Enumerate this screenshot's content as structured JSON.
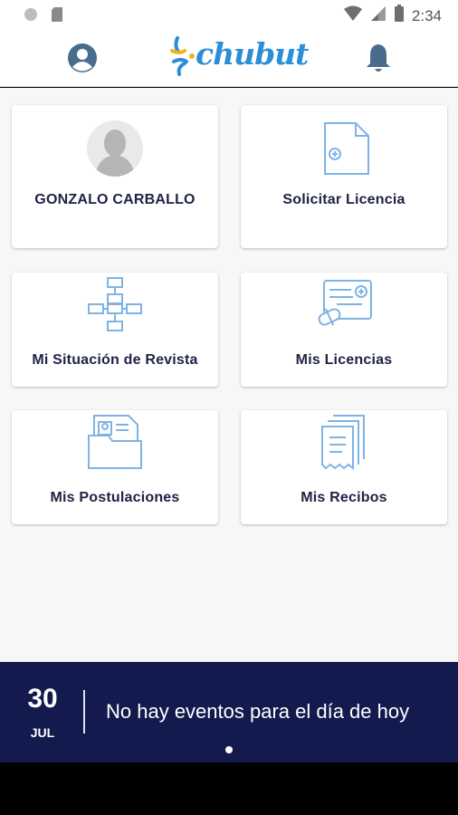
{
  "status_bar": {
    "time": "2:34",
    "icons": [
      "circle-icon",
      "sd-card-icon",
      "wifi-icon",
      "signal-icon",
      "battery-icon"
    ]
  },
  "app_bar": {
    "logo_text": "chubut",
    "icons": [
      "profile-icon",
      "bell-icon"
    ],
    "accent_color": "#2a8fd6"
  },
  "cards": [
    {
      "label": "GONZALO CARBALLO",
      "icon": "avatar-placeholder"
    },
    {
      "label": "Solicitar Licencia",
      "icon": "document-add-icon"
    },
    {
      "label": "Mi Situación de Revista",
      "icon": "org-chart-icon"
    },
    {
      "label": "Mis Licencias",
      "icon": "license-card-icon"
    },
    {
      "label": "Mis Postulaciones",
      "icon": "folder-id-icon"
    },
    {
      "label": "Mis Recibos",
      "icon": "receipts-icon"
    }
  ],
  "events": {
    "day": "30",
    "month": "JUL",
    "message": "No hay eventos para el día de hoy",
    "background": "#121a4e"
  }
}
